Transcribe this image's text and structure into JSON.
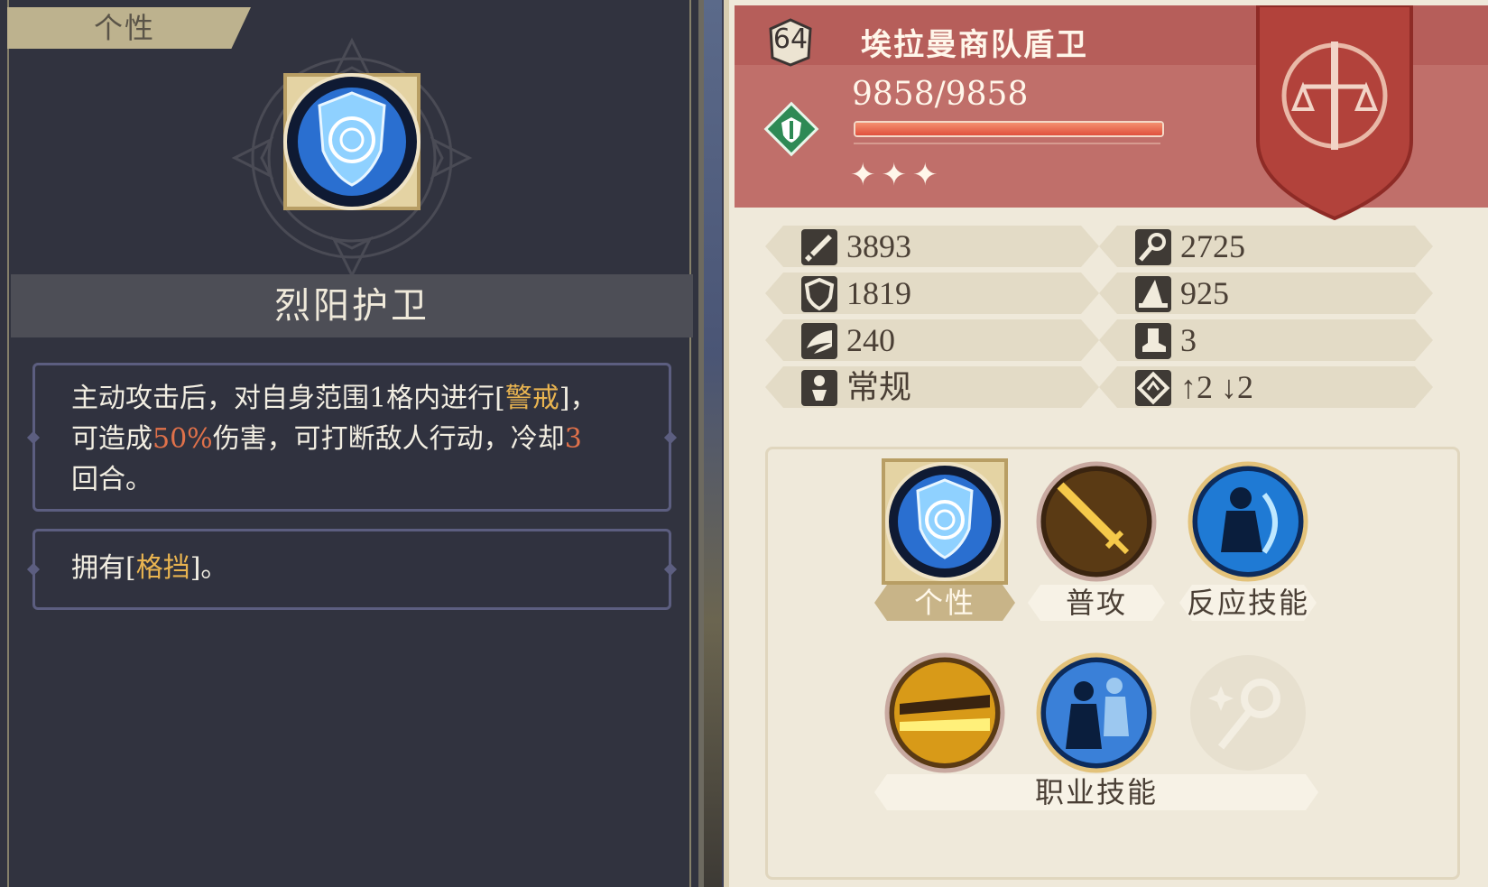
{
  "left": {
    "tab_label": "个性",
    "skill_name": "烈阳护卫",
    "desc": {
      "line1_a": "主动攻击后，对自身范围1格内进行[",
      "line1_kw": "警戒",
      "line1_b": "]，",
      "line2_a": "可造成",
      "line2_num": "50%",
      "line2_b": "伤害，可打断敌人行动，冷却",
      "line2_num2": "3",
      "line3": "回合。"
    },
    "sub": {
      "a": "拥有[",
      "kw": "格挡",
      "b": "]。"
    }
  },
  "unit": {
    "level": "64",
    "name": "埃拉曼商队盾卫",
    "hp_text": "9858/9858",
    "hp_fraction": 1.0,
    "stars": "✦✦✦",
    "class_icon": "shield-class-icon",
    "crest_icon": "sword-scales-crest-icon"
  },
  "stats": [
    {
      "icon": "sword-icon",
      "value": "3893"
    },
    {
      "icon": "staff-icon",
      "value": "2725"
    },
    {
      "icon": "shield-icon",
      "value": "1819"
    },
    {
      "icon": "wizard-hat-icon",
      "value": "925"
    },
    {
      "icon": "wing-icon",
      "value": "240"
    },
    {
      "icon": "boot-icon",
      "value": "3"
    },
    {
      "icon": "figure-icon",
      "value": "常规"
    },
    {
      "icon": "elevation-icon",
      "value": "↑2 ↓2"
    }
  ],
  "skills": {
    "trait_label": "个性",
    "attack_label": "普攻",
    "reaction_label": "反应技能",
    "class_label": "职业技能"
  },
  "colors": {
    "header": "#c06f6a",
    "keyword": "#e9b450",
    "number": "#e0714a"
  }
}
